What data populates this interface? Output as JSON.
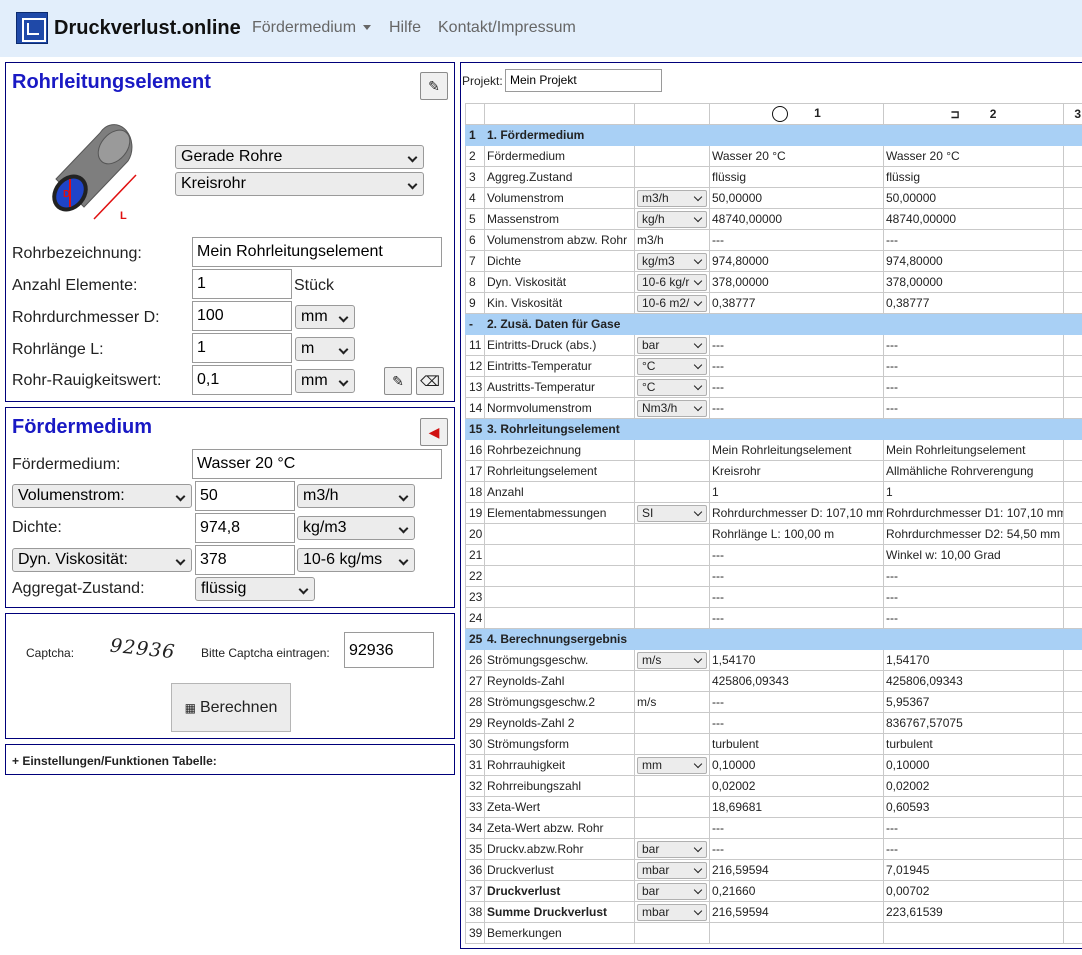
{
  "brand": {
    "name": "Druckverlust.online"
  },
  "nav": {
    "item1": "Fördermedium",
    "item2": "Hilfe",
    "item3": "Kontakt/Impressum"
  },
  "rohr": {
    "title": "Rohrleitungselement",
    "type_select": "Gerade Rohre",
    "shape_select": "Kreisrohr",
    "img_label_d": "D",
    "img_label_l": "L",
    "fields": {
      "name_label": "Rohrbezeichnung:",
      "name_value": "Mein Rohrleitungselement",
      "count_label": "Anzahl Elemente:",
      "count_value": "1",
      "count_unit": "Stück",
      "diam_label": "Rohrdurchmesser D:",
      "diam_value": "100",
      "diam_unit": "mm",
      "len_label": "Rohrlänge L:",
      "len_value": "1",
      "len_unit": "m",
      "rough_label": "Rohr-Rauigkeitswert:",
      "rough_value": "0,1",
      "rough_unit": "mm"
    }
  },
  "medium": {
    "title": "Fördermedium",
    "fm_label": "Fördermedium:",
    "fm_value": "Wasser 20 °C",
    "flow_select": "Volumenstrom:",
    "flow_value": "50",
    "flow_unit": "m3/h",
    "density_label": "Dichte:",
    "density_value": "974,8",
    "density_unit": "kg/m3",
    "visc_select": "Dyn. Viskosität:",
    "visc_value": "378",
    "visc_unit": "10-6 kg/ms",
    "agg_label": "Aggregat-Zustand:",
    "agg_value": "flüssig"
  },
  "captcha": {
    "label": "Captcha:",
    "image_text": "92936",
    "prompt": "Bitte Captcha eintragen:",
    "value": "92936",
    "button": "Berechnen"
  },
  "settings": {
    "label": "+ Einstellungen/Funktionen Tabelle:"
  },
  "project": {
    "label": "Projekt:",
    "value": "Mein Projekt"
  },
  "table": {
    "col1": "1",
    "col2": "2",
    "col3": "3",
    "rows": [
      {
        "n": "1",
        "label": "1. Fördermedium",
        "section": true
      },
      {
        "n": "2",
        "label": "Fördermedium",
        "unit": "",
        "v1": "Wasser 20 °C",
        "v2": "Wasser 20 °C"
      },
      {
        "n": "3",
        "label": "Aggreg.Zustand",
        "unit": "",
        "v1": "flüssig",
        "v2": "flüssig"
      },
      {
        "n": "4",
        "label": "Volumenstrom",
        "unit": "m3/h",
        "unitsel": true,
        "v1": "50,00000",
        "v2": "50,00000"
      },
      {
        "n": "5",
        "label": "Massenstrom",
        "unit": "kg/h",
        "unitsel": true,
        "v1": "48740,00000",
        "v2": "48740,00000"
      },
      {
        "n": "6",
        "label": "Volumenstrom abzw. Rohr",
        "unit": "m3/h",
        "v1": "---",
        "v2": "---"
      },
      {
        "n": "7",
        "label": "Dichte",
        "unit": "kg/m3",
        "unitsel": true,
        "v1": "974,80000",
        "v2": "974,80000"
      },
      {
        "n": "8",
        "label": "Dyn. Viskosität",
        "unit": "10-6 kg/r",
        "unitsel": true,
        "v1": "378,00000",
        "v2": "378,00000"
      },
      {
        "n": "9",
        "label": "Kin. Viskosität",
        "unit": "10-6 m2/",
        "unitsel": true,
        "v1": "0,38777",
        "v2": "0,38777"
      },
      {
        "n": "-",
        "label": "2. Zusä. Daten für Gase",
        "section": true
      },
      {
        "n": "11",
        "label": "Eintritts-Druck (abs.)",
        "unit": "bar",
        "unitsel": true,
        "v1": "---",
        "v2": "---"
      },
      {
        "n": "12",
        "label": "Eintritts-Temperatur",
        "unit": "°C",
        "unitsel": true,
        "v1": "---",
        "v2": "---"
      },
      {
        "n": "13",
        "label": "Austritts-Temperatur",
        "unit": "°C",
        "unitsel": true,
        "v1": "---",
        "v2": "---"
      },
      {
        "n": "14",
        "label": "Normvolumenstrom",
        "unit": "Nm3/h",
        "unitsel": true,
        "v1": "---",
        "v2": "---"
      },
      {
        "n": "15",
        "label": "3. Rohrleitungselement",
        "section": true
      },
      {
        "n": "16",
        "label": "Rohrbezeichnung",
        "unit": "",
        "v1": "Mein Rohrleitungselement",
        "v2": "Mein Rohrleitungselement"
      },
      {
        "n": "17",
        "label": "Rohrleitungselement",
        "unit": "",
        "v1": "Kreisrohr",
        "v2": "Allmähliche Rohrverengung"
      },
      {
        "n": "18",
        "label": "Anzahl",
        "unit": "",
        "v1": "1",
        "v2": "1"
      },
      {
        "n": "19",
        "label": "Elementabmessungen",
        "unit": "SI",
        "unitsel": true,
        "v1": "Rohrdurchmesser D: 107,10 mm",
        "v2": "Rohrdurchmesser D1: 107,10 mm"
      },
      {
        "n": "20",
        "label": "",
        "unit": "",
        "v1": "Rohrlänge L: 100,00 m",
        "v2": "Rohrdurchmesser D2: 54,50 mm"
      },
      {
        "n": "21",
        "label": "",
        "unit": "",
        "v1": "---",
        "v2": "Winkel w: 10,00 Grad"
      },
      {
        "n": "22",
        "label": "",
        "unit": "",
        "v1": "---",
        "v2": "---"
      },
      {
        "n": "23",
        "label": "",
        "unit": "",
        "v1": "---",
        "v2": "---"
      },
      {
        "n": "24",
        "label": "",
        "unit": "",
        "v1": "---",
        "v2": "---"
      },
      {
        "n": "25",
        "label": "4. Berechnungsergebnis",
        "section": true
      },
      {
        "n": "26",
        "label": "Strömungsgeschw.",
        "unit": "m/s",
        "unitsel": true,
        "v1": "1,54170",
        "v2": "1,54170"
      },
      {
        "n": "27",
        "label": "Reynolds-Zahl",
        "unit": "",
        "v1": "425806,09343",
        "v2": "425806,09343"
      },
      {
        "n": "28",
        "label": "Strömungsgeschw.2",
        "unit": "m/s",
        "v1": "---",
        "v2": "5,95367"
      },
      {
        "n": "29",
        "label": "Reynolds-Zahl 2",
        "unit": "",
        "v1": "---",
        "v2": "836767,57075"
      },
      {
        "n": "30",
        "label": "Strömungsform",
        "unit": "",
        "v1": "turbulent",
        "v2": "turbulent"
      },
      {
        "n": "31",
        "label": "Rohrrauhigkeit",
        "unit": "mm",
        "unitsel": true,
        "v1": "0,10000",
        "v2": "0,10000"
      },
      {
        "n": "32",
        "label": "Rohrreibungszahl",
        "unit": "",
        "v1": "0,02002",
        "v2": "0,02002"
      },
      {
        "n": "33",
        "label": "Zeta-Wert",
        "unit": "",
        "v1": "18,69681",
        "v2": "0,60593"
      },
      {
        "n": "34",
        "label": "Zeta-Wert abzw. Rohr",
        "unit": "",
        "v1": "---",
        "v2": "---"
      },
      {
        "n": "35",
        "label": "Druckv.abzw.Rohr",
        "unit": "bar",
        "unitsel": true,
        "v1": "---",
        "v2": "---"
      },
      {
        "n": "36",
        "label": "Druckverlust",
        "unit": "mbar",
        "unitsel": true,
        "v1": "216,59594",
        "v2": "7,01945"
      },
      {
        "n": "37",
        "label": "Druckverlust",
        "unit": "bar",
        "unitsel": true,
        "bold": true,
        "v1": "0,21660",
        "v2": "0,00702"
      },
      {
        "n": "38",
        "label": "Summe Druckverlust",
        "unit": "mbar",
        "unitsel": true,
        "bold": true,
        "v1": "216,59594",
        "v2": "223,61539"
      },
      {
        "n": "39",
        "label": "Bemerkungen",
        "unit": "",
        "v1": "",
        "v2": ""
      }
    ]
  }
}
